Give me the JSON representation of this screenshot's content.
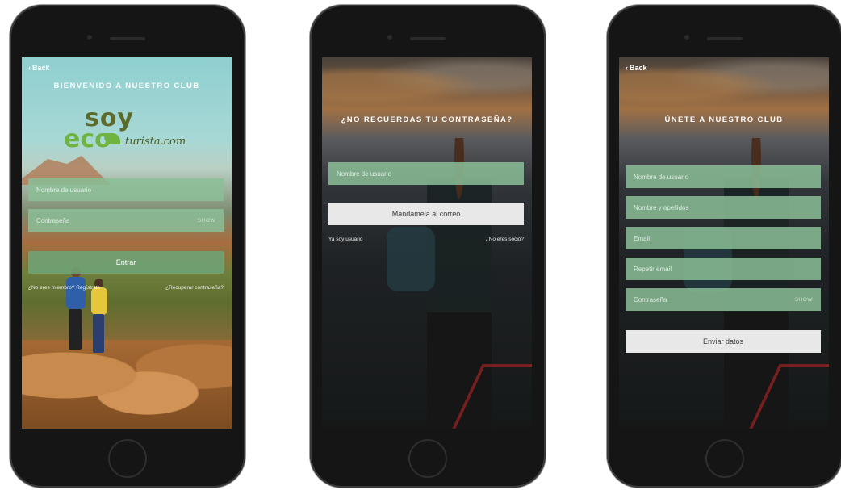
{
  "screens": {
    "login": {
      "back": "Back",
      "title": "BIENVENIDO A NUESTRO CLUB",
      "logo": {
        "line1": "soy",
        "line2": "eco",
        "line3": "turista.com"
      },
      "username_placeholder": "Nombre de usuario",
      "password_placeholder": "Contraseña",
      "password_show": "SHOW",
      "submit_label": "Entrar",
      "link_left": "¿No eres miembro? Regístrate",
      "link_right": "¿Recuperar contraseña?"
    },
    "recover": {
      "title": "¿NO RECUERDAS TU CONTRASEÑA?",
      "username_placeholder": "Nombre de usuario",
      "submit_label": "Mándamela al correo",
      "link_left": "Ya soy usuario",
      "link_right": "¿No eres socio?"
    },
    "register": {
      "back": "Back",
      "title": "ÚNETE A NUESTRO CLUB",
      "fields": [
        "Nombre de usuario",
        "Nombre y apellidos",
        "Email",
        "Repetir email",
        "Contraseña"
      ],
      "password_show": "SHOW",
      "submit_label": "Enviar datos"
    }
  },
  "colors": {
    "field_green": "#8bbe96",
    "logo_dark": "#5c6b2b",
    "logo_green": "#6fb441",
    "button_light": "#e8e8e8"
  }
}
